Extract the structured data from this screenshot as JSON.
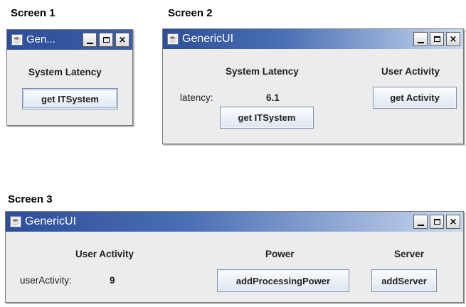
{
  "captions": {
    "screen1": "Screen 1",
    "screen2": "Screen 2",
    "screen3": "Screen 3"
  },
  "window1": {
    "title": "Gen...",
    "heading": "System Latency",
    "button": "get ITSystem",
    "controls": {
      "close": "×"
    }
  },
  "window2": {
    "title": "GenericUI",
    "heading_latency": "System Latency",
    "heading_activity": "User Activity",
    "latency_label": "latency:",
    "latency_value": "6.1",
    "button_itsystem": "get ITSystem",
    "button_activity": "get Activity",
    "controls": {
      "close": "×"
    }
  },
  "window3": {
    "title": "GenericUI",
    "heading_activity": "User Activity",
    "heading_power": "Power",
    "heading_server": "Server",
    "activity_label": "userActivity:",
    "activity_value": "9",
    "button_power": "addProcessingPower",
    "button_server": "addServer",
    "controls": {
      "close": "×"
    }
  },
  "icons": [
    "java-cup-icon",
    "minimize-icon",
    "maximize-icon",
    "close-icon"
  ],
  "colors": {
    "titlebar_dark": "#2d4e98",
    "titlebar_light": "#c9d9ef",
    "window_bg": "#ececec"
  }
}
